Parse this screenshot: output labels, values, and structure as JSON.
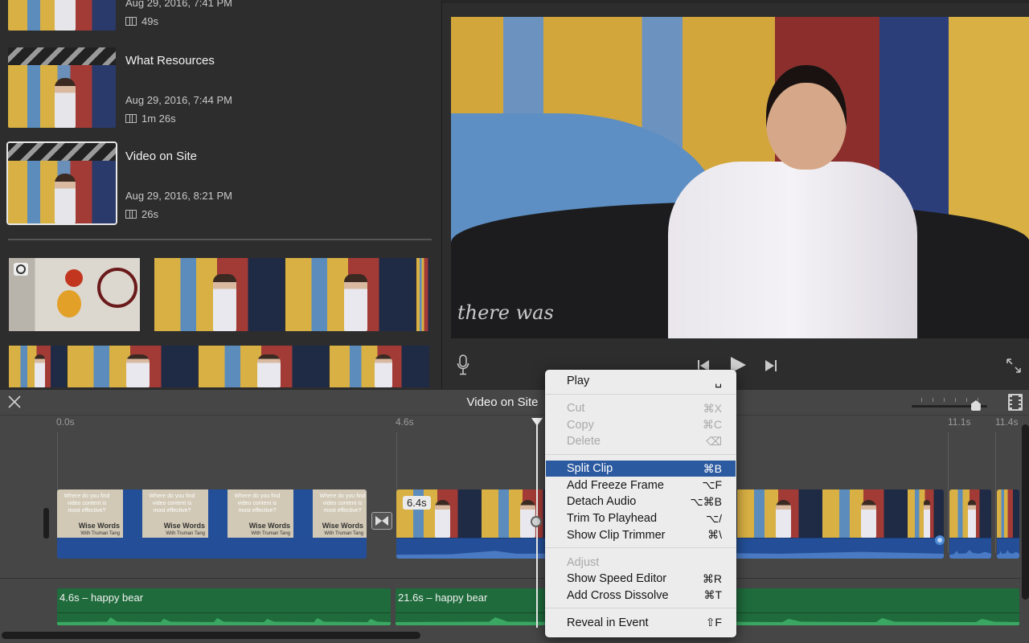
{
  "browser": {
    "projects": [
      {
        "title": "",
        "date": "Aug 29, 2016, 7:41 PM",
        "duration": "49s",
        "selected": false
      },
      {
        "title": "What Resources",
        "date": "Aug 29, 2016, 7:44 PM",
        "duration": "1m 26s",
        "selected": false
      },
      {
        "title": "Video on Site",
        "date": "Aug 29, 2016, 8:21 PM",
        "duration": "26s",
        "selected": true
      }
    ],
    "media_icon": "camera-icon"
  },
  "viewer": {
    "chalk_text": "there was",
    "controls": {
      "voiceover": "microphone-icon",
      "previous": "skip-back-icon",
      "play": "play-icon",
      "next": "skip-forward-icon",
      "fullscreen": "expand-icon"
    }
  },
  "timeline": {
    "title": "Video on Site",
    "close_icon": "close-icon",
    "zoom_level": 0.85,
    "ruler": [
      "0.0s",
      "4.6s",
      "11.1s",
      "11.4s"
    ],
    "clips": [
      {
        "type": "title",
        "question": "Where do you find video content is most effective?",
        "title": "Wise Words",
        "subtitle": "With Truman Tang"
      },
      {
        "type": "video",
        "badge": "6.4s"
      }
    ],
    "music": [
      {
        "label": "4.6s – happy bear"
      },
      {
        "label": "21.6s – happy bear"
      }
    ]
  },
  "context_menu": {
    "items": [
      {
        "label": "Play",
        "shortcut": "␣",
        "state": "enabled"
      },
      {
        "sep": true
      },
      {
        "label": "Cut",
        "shortcut": "⌘X",
        "state": "disabled"
      },
      {
        "label": "Copy",
        "shortcut": "⌘C",
        "state": "disabled"
      },
      {
        "label": "Delete",
        "shortcut": "⌫",
        "state": "disabled"
      },
      {
        "sep": true
      },
      {
        "label": "Split Clip",
        "shortcut": "⌘B",
        "state": "highlighted"
      },
      {
        "label": "Add Freeze Frame",
        "shortcut": "⌥F",
        "state": "enabled"
      },
      {
        "label": "Detach Audio",
        "shortcut": "⌥⌘B",
        "state": "enabled"
      },
      {
        "label": "Trim To Playhead",
        "shortcut": "⌥/",
        "state": "enabled"
      },
      {
        "label": "Show Clip Trimmer",
        "shortcut": "⌘\\",
        "state": "enabled"
      },
      {
        "sep": true
      },
      {
        "label": "Adjust",
        "shortcut": "",
        "state": "header"
      },
      {
        "label": "Show Speed Editor",
        "shortcut": "⌘R",
        "state": "enabled"
      },
      {
        "label": "Add Cross Dissolve",
        "shortcut": "⌘T",
        "state": "enabled"
      },
      {
        "sep": true
      },
      {
        "label": "Reveal in Event",
        "shortcut": "⇧F",
        "state": "enabled"
      }
    ]
  }
}
